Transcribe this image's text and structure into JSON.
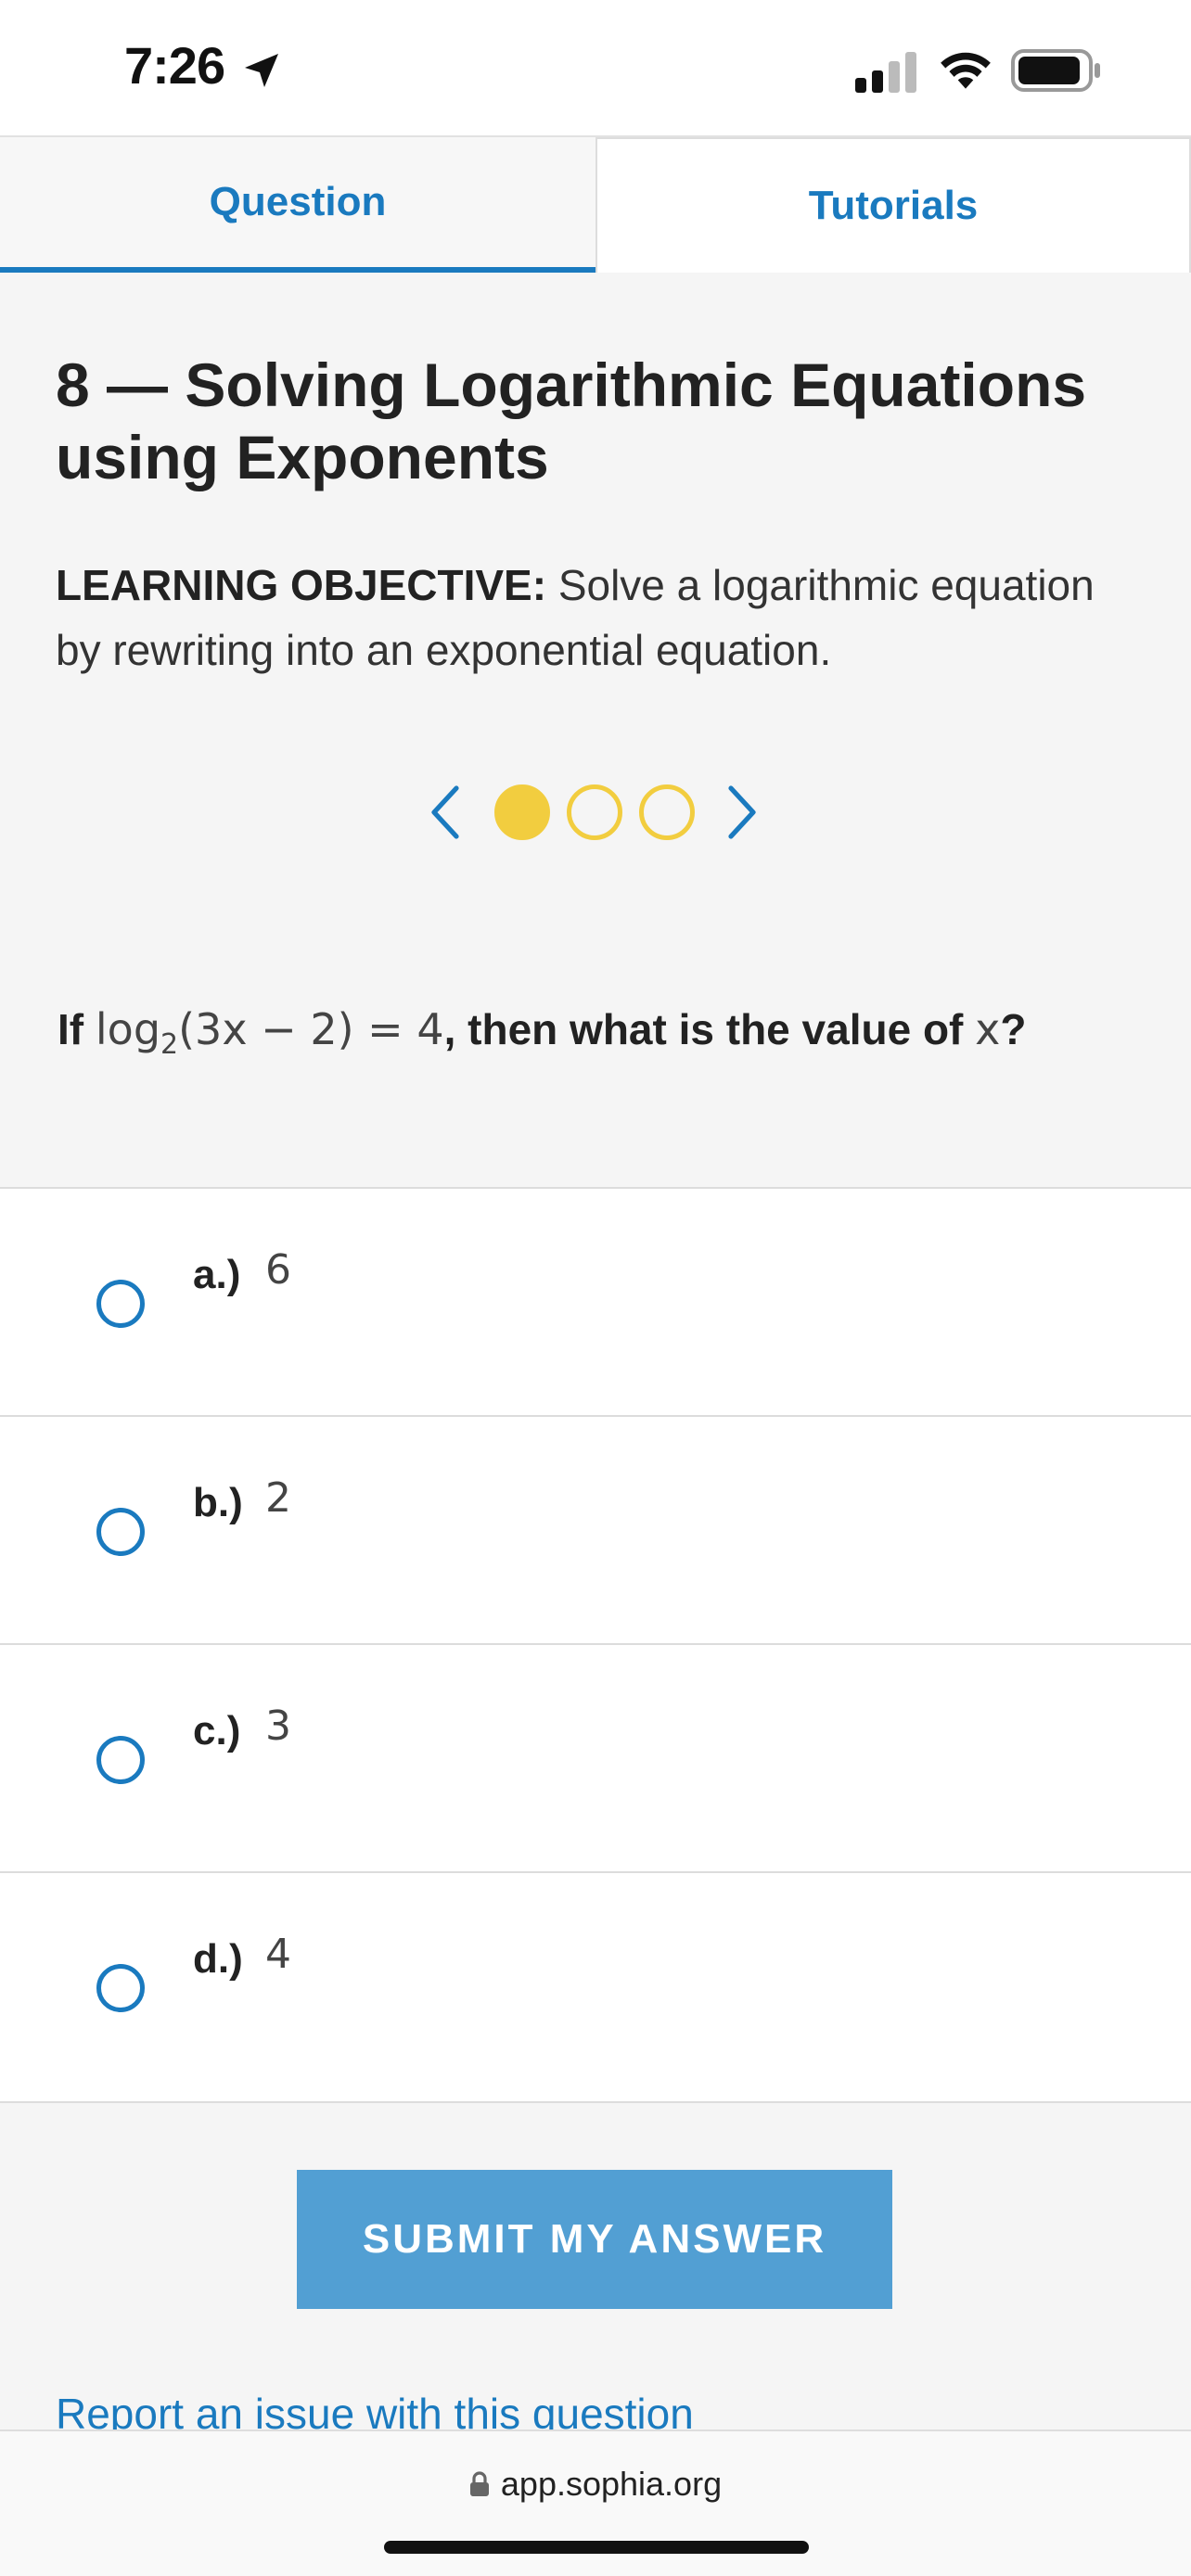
{
  "status_bar": {
    "time": "7:26"
  },
  "tabs": [
    {
      "label": "Question",
      "active": true
    },
    {
      "label": "Tutorials",
      "active": false
    }
  ],
  "page": {
    "title": "8 — Solving Logarithmic Equations using Exponents",
    "objective_label": "LEARNING OBJECTIVE:",
    "objective_text": " Solve a logarithmic equation by rewriting into an exponential equation."
  },
  "pager": {
    "current": 1,
    "total": 3
  },
  "question": {
    "prefix": "If ",
    "math_log": "log",
    "math_base": "2",
    "math_rest": "(3x − 2) = 4",
    "middle": ", then what is the value of ",
    "math_var": "x",
    "suffix": "?"
  },
  "answers": [
    {
      "letter": "a.)",
      "value": "6"
    },
    {
      "letter": "b.)",
      "value": "2"
    },
    {
      "letter": "c.)",
      "value": "3"
    },
    {
      "letter": "d.)",
      "value": "4"
    }
  ],
  "submit_label": "SUBMIT MY ANSWER",
  "report_link": "Report an issue with this question",
  "url": "app.sophia.org",
  "colors": {
    "accent": "#1a7abf",
    "button": "#529fd3",
    "dot": "#f2cd3f"
  }
}
